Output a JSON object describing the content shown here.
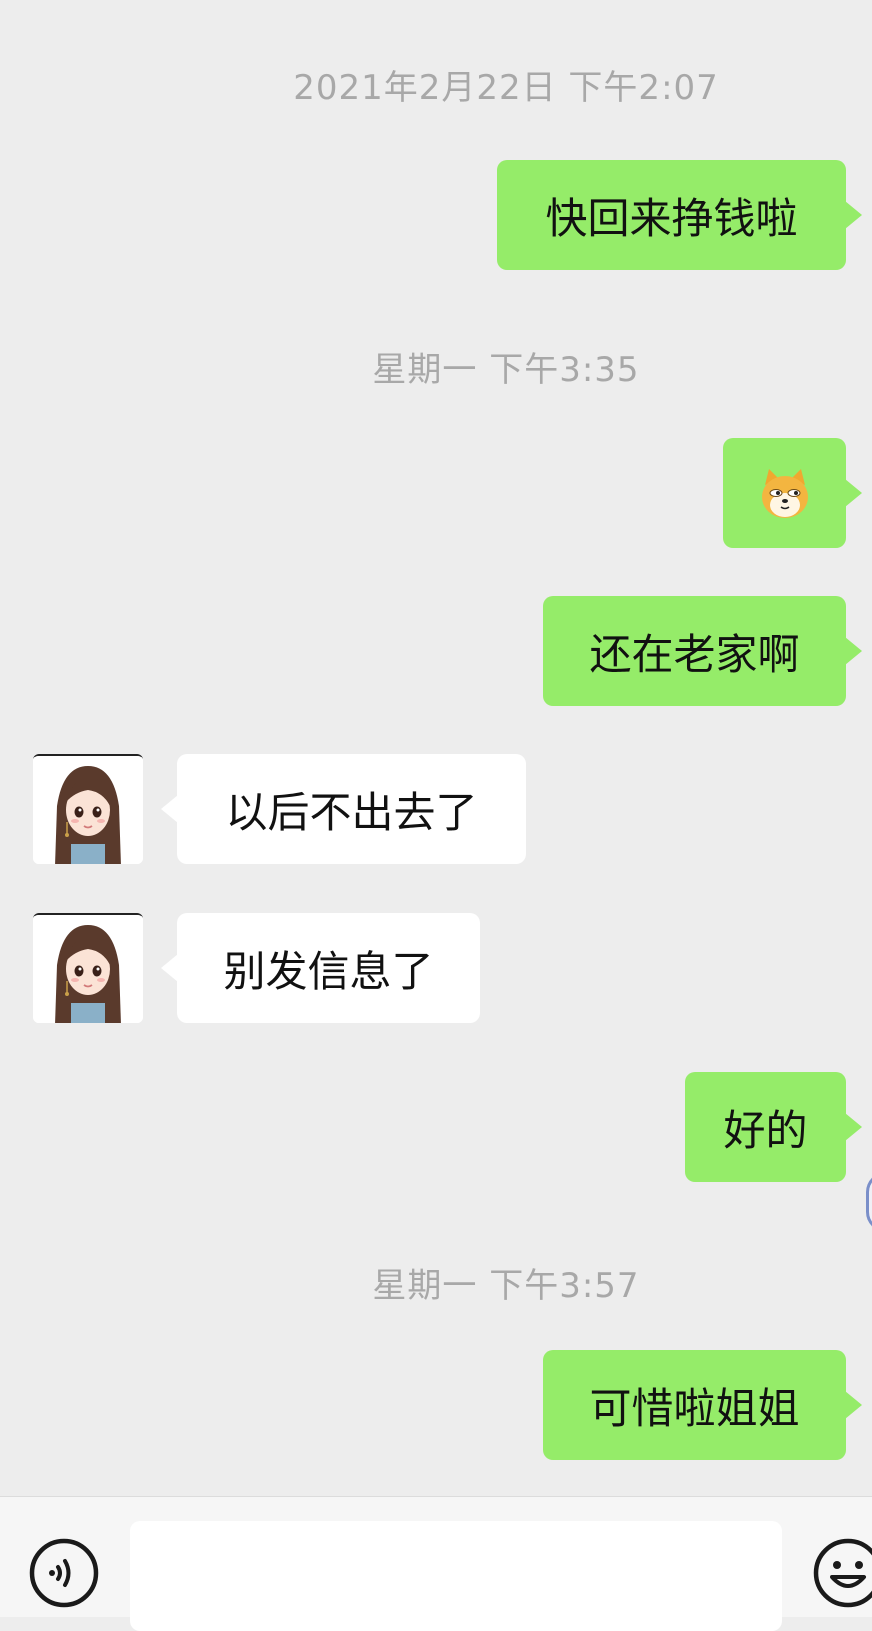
{
  "timestamps": [
    "2021年2月22日 下午2:07",
    "星期一 下午3:35",
    "星期一 下午3:57"
  ],
  "messages": {
    "m1": "快回来挣钱啦",
    "m3": "还在老家啊",
    "m4": "以后不出去了",
    "m5": "别发信息了",
    "m6": "好的",
    "m7": "可惜啦姐姐"
  },
  "sticker": "doge-sticker",
  "input": {
    "value": "",
    "placeholder": ""
  },
  "icons": {
    "voice": "voice-icon",
    "emoji": "emoji-icon"
  },
  "colors": {
    "background": "#ededed",
    "sent_bubble": "#95ec69",
    "received_bubble": "#ffffff",
    "timestamp_text": "#a8a8a8"
  }
}
